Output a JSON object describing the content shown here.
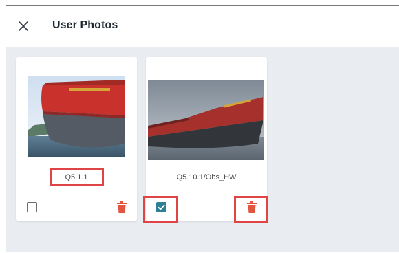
{
  "dialog": {
    "title": "User Photos"
  },
  "photos": [
    {
      "caption": "Q5.1.1",
      "checked": false,
      "icons": {
        "select": "checkbox-unchecked-icon",
        "delete": "trash-icon"
      }
    },
    {
      "caption": "Q5.10.1/Obs_HW",
      "checked": true,
      "icons": {
        "select": "checkbox-checked-icon",
        "delete": "trash-icon"
      }
    }
  ],
  "colors": {
    "delete": "#e2553e",
    "checkbox_checked": "#2f7f95",
    "highlight": "#e04545",
    "background": "#e9edf2"
  }
}
